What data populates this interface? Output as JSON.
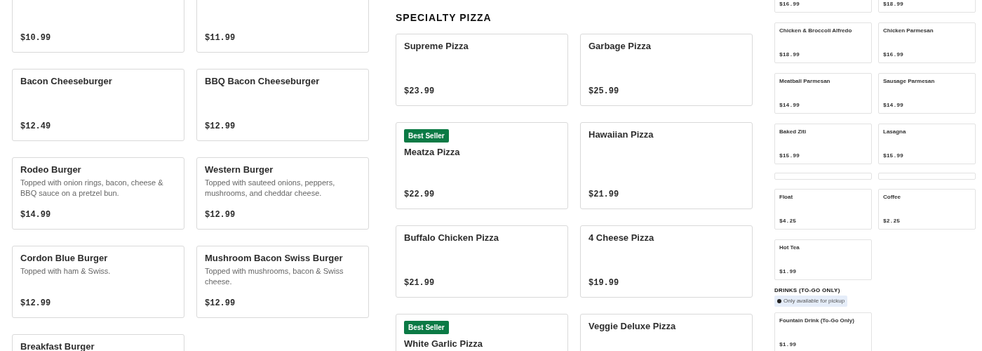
{
  "panels": [
    {
      "sections": [
        {
          "items": [
            {
              "price": "$10.99"
            },
            {
              "price": "$11.99"
            },
            {
              "name": "Bacon Cheeseburger",
              "price": "$12.49"
            },
            {
              "name": "BBQ Bacon Cheeseburger",
              "price": "$12.99"
            },
            {
              "name": "Rodeo Burger",
              "description": "Topped with onion rings, bacon, cheese & BBQ sauce on a pretzel bun.",
              "price": "$14.99"
            },
            {
              "name": "Western Burger",
              "description": "Topped with sauteed onions, peppers, mushrooms, and cheddar cheese.",
              "price": "$12.99"
            },
            {
              "name": "Cordon Blue Burger",
              "description": "Topped with ham & Swiss.",
              "price": "$12.99"
            },
            {
              "name": "Mushroom Bacon Swiss Burger",
              "description": "Topped with mushrooms, bacon & Swiss cheese.",
              "price": "$12.99"
            },
            {
              "name": "Breakfast Burger"
            }
          ]
        }
      ]
    },
    {
      "sections": [
        {
          "title": "SPECIALTY PIZZA",
          "items": [
            {
              "name": "Supreme Pizza",
              "price": "$23.99"
            },
            {
              "name": "Garbage Pizza",
              "price": "$25.99"
            },
            {
              "badge": "Best Seller",
              "name": "Meatza Pizza",
              "price": "$22.99"
            },
            {
              "name": "Hawaiian Pizza",
              "price": "$21.99"
            },
            {
              "name": "Buffalo Chicken Pizza",
              "price": "$21.99"
            },
            {
              "name": "4 Cheese Pizza",
              "price": "$19.99"
            },
            {
              "badge": "Best Seller",
              "name": "White Garlic Pizza"
            },
            {
              "name": "Veggie Deluxe Pizza"
            }
          ]
        }
      ]
    },
    {
      "sections": [
        {
          "items": [
            {
              "price": "$16.99"
            },
            {
              "price": "$18.99"
            },
            {
              "name": "Chicken & Broccoli Alfredo",
              "price": "$18.99"
            },
            {
              "name": "Chicken Parmesan",
              "price": "$16.99"
            },
            {
              "name": "Meatball Parmesan",
              "price": "$14.99"
            },
            {
              "name": "Sausage Parmesan",
              "price": "$14.99"
            },
            {
              "name": "Baked Ziti",
              "price": "$15.99"
            },
            {
              "name": "Lasagna",
              "price": "$15.99"
            }
          ]
        },
        {
          "items": [
            {
              "name": "Float",
              "price": "$4.25"
            },
            {
              "name": "Coffee",
              "price": "$2.25"
            },
            {
              "name": "Hot Tea",
              "price": "$1.99"
            }
          ]
        },
        {
          "title": "DRINKS (TO-GO ONLY)",
          "notice": "Only available for pickup",
          "items": [
            {
              "name": "Fountain Drink (To-Go Only)",
              "price": "$1.99"
            }
          ]
        }
      ]
    }
  ]
}
